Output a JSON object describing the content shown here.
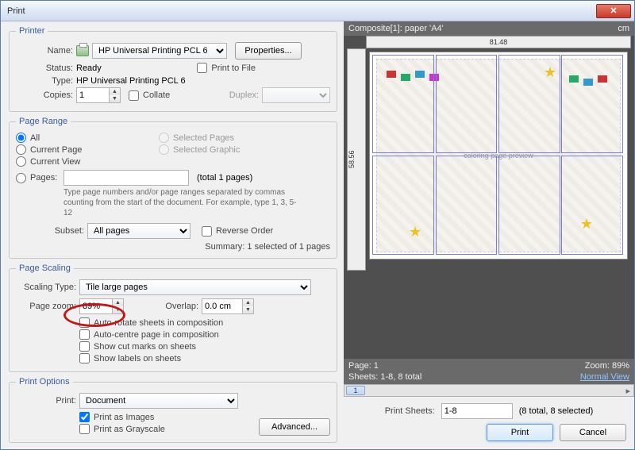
{
  "title": "Print",
  "printer": {
    "legend": "Printer",
    "name_label": "Name:",
    "name_value": "HP Universal Printing PCL 6",
    "properties_btn": "Properties...",
    "status_label": "Status:",
    "status_value": "Ready",
    "type_label": "Type:",
    "type_value": "HP Universal Printing PCL 6",
    "print_to_file": "Print to File",
    "copies_label": "Copies:",
    "copies_value": "1",
    "collate": "Collate",
    "duplex_label": "Duplex:"
  },
  "page_range": {
    "legend": "Page Range",
    "all": "All",
    "current_page": "Current Page",
    "current_view": "Current View",
    "pages": "Pages:",
    "selected_pages": "Selected Pages",
    "selected_graphic": "Selected Graphic",
    "total": "(total 1 pages)",
    "hint": "Type page numbers and/or page ranges separated by commas counting from the start of the document. For example, type 1, 3, 5-12",
    "subset_label": "Subset:",
    "subset_value": "All pages",
    "reverse_order": "Reverse Order",
    "summary": "Summary: 1 selected of 1 pages"
  },
  "page_scaling": {
    "legend": "Page Scaling",
    "scaling_type_label": "Scaling Type:",
    "scaling_type_value": "Tile large pages",
    "page_zoom_label": "Page zoom:",
    "page_zoom_value": "89%",
    "overlap_label": "Overlap:",
    "overlap_value": "0.0 cm",
    "auto_rotate": "Auto-rotate sheets in composition",
    "auto_centre": "Auto-centre page in composition",
    "show_cut": "Show cut marks on sheets",
    "show_labels": "Show labels on sheets"
  },
  "print_options": {
    "legend": "Print Options",
    "print_label": "Print:",
    "print_value": "Document",
    "as_images": "Print as Images",
    "as_grayscale": "Print as Grayscale",
    "advanced_btn": "Advanced..."
  },
  "preview": {
    "header_left": "Composite[1]: paper 'A4'",
    "header_right": "cm",
    "ruler_w": "81.48",
    "ruler_h": "58.56",
    "page_label": "Page: 1",
    "zoom_label": "Zoom: 89%",
    "sheets_label": "Sheets: 1-8, 8 total",
    "normal_view": "Normal View",
    "scroll_value": "1"
  },
  "footer": {
    "print_sheets_label": "Print Sheets:",
    "print_sheets_value": "1-8",
    "print_sheets_info": "(8 total, 8 selected)",
    "print_btn": "Print",
    "cancel_btn": "Cancel"
  }
}
